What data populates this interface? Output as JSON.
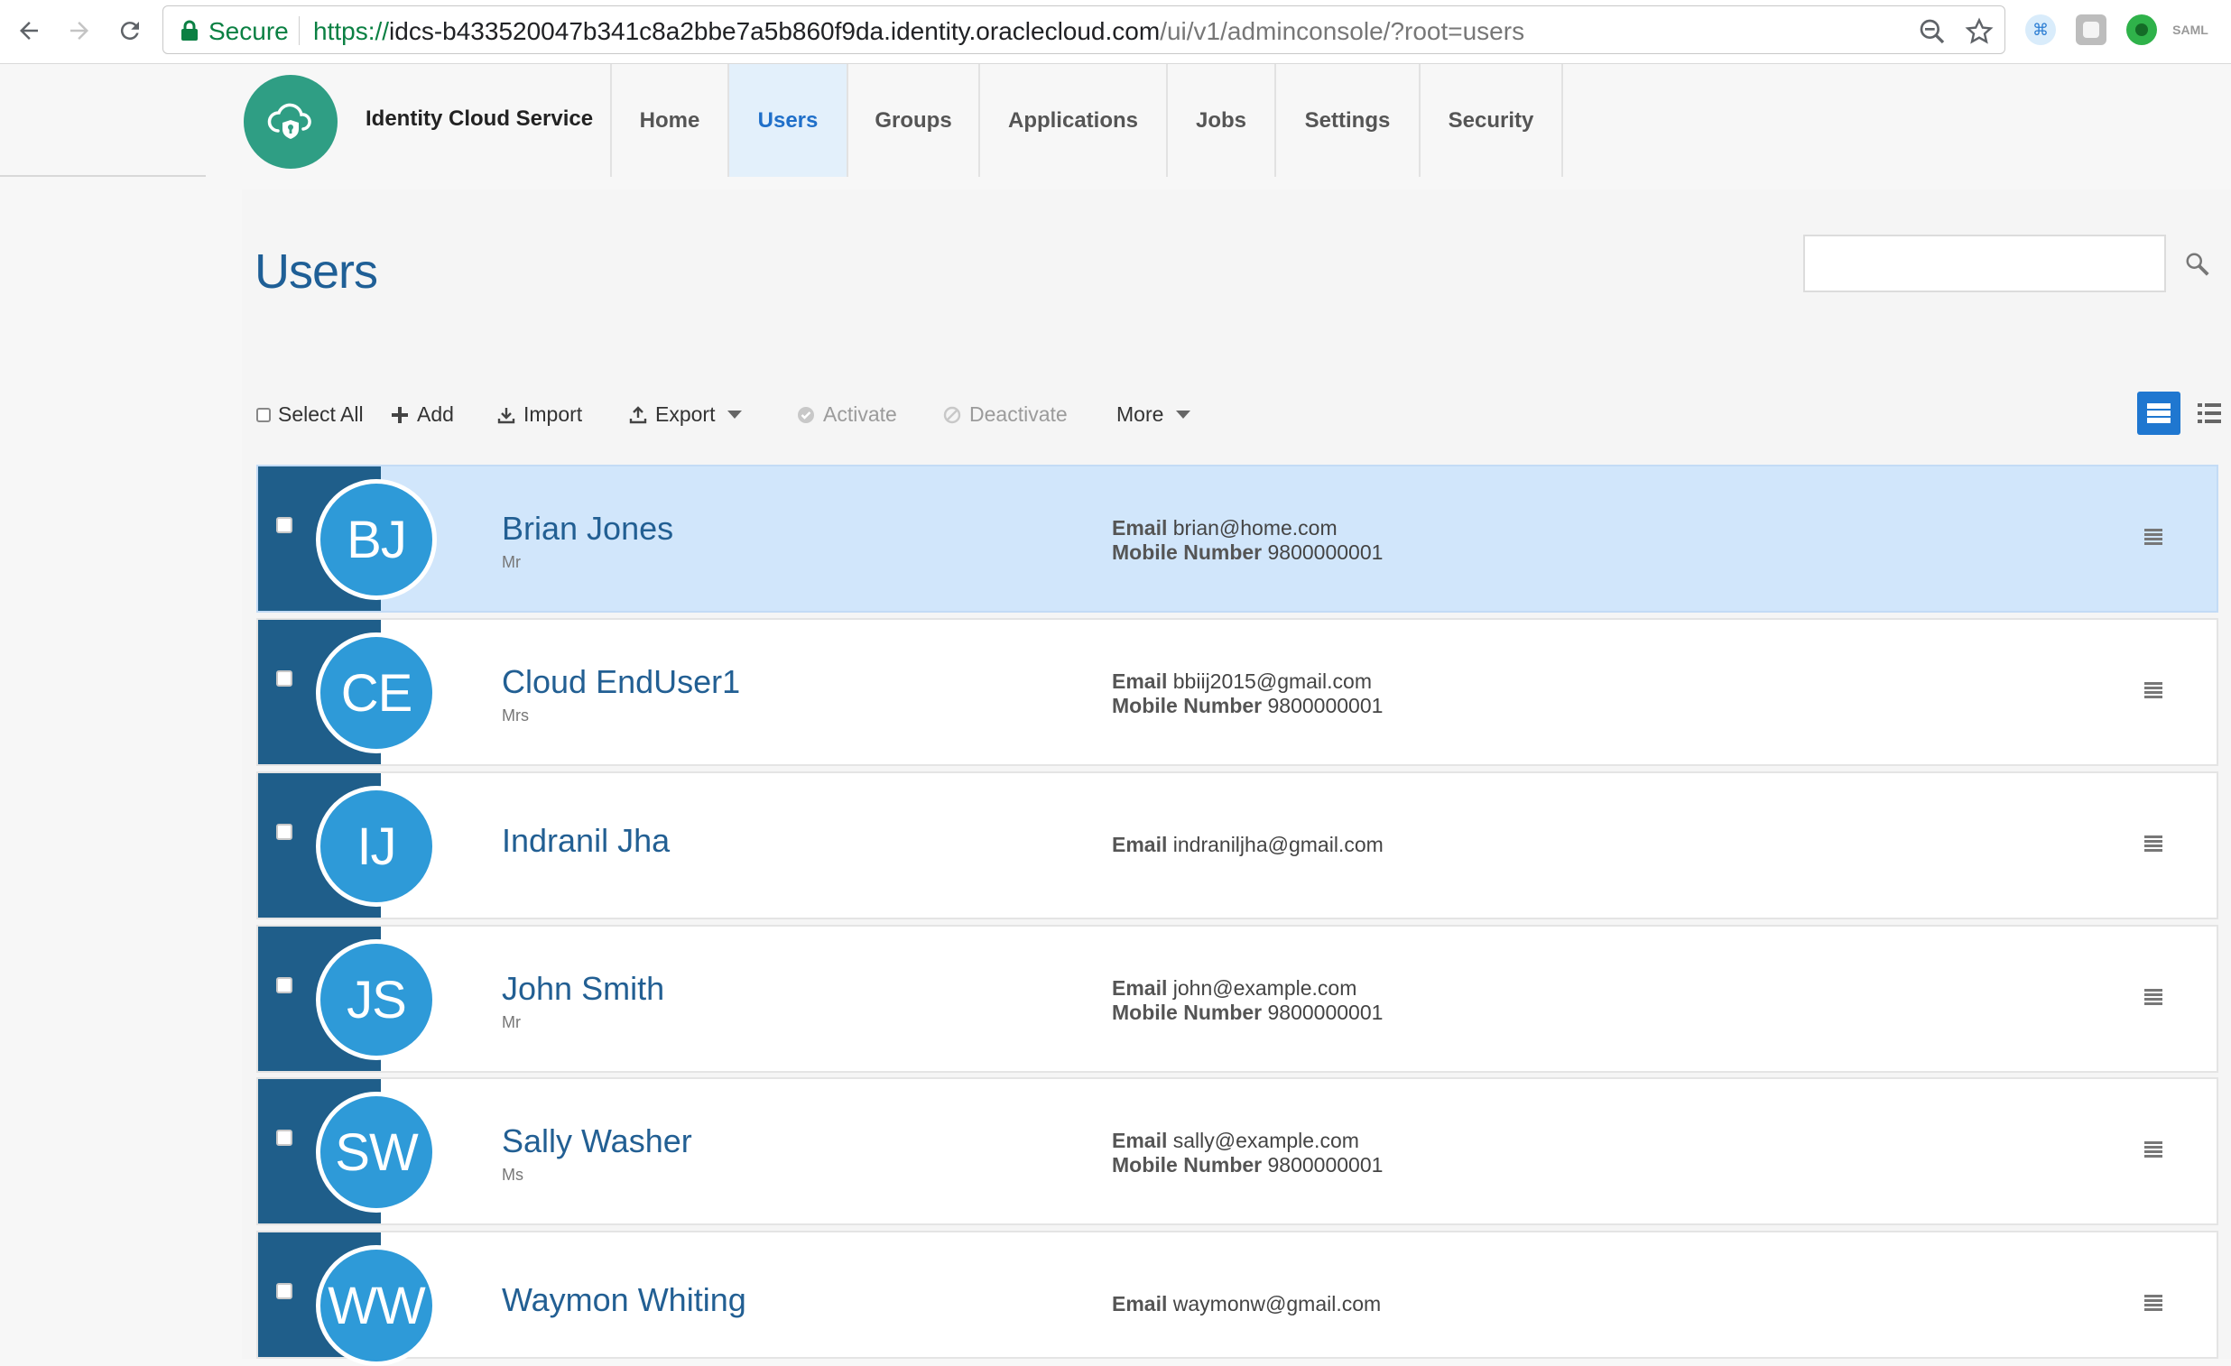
{
  "browser": {
    "secure_label": "Secure",
    "url_protocol": "https://",
    "url_host": "idcs-b433520047b341c8a2bbe7a5b860f9da.identity.oraclecloud.com",
    "url_path": "/ui/v1/adminconsole/?root=users",
    "extension_saml_label": "SAML"
  },
  "header": {
    "brand": "Identity Cloud Service",
    "tabs": [
      {
        "label": "Home",
        "active": false
      },
      {
        "label": "Users",
        "active": true
      },
      {
        "label": "Groups",
        "active": false
      },
      {
        "label": "Applications",
        "active": false
      },
      {
        "label": "Jobs",
        "active": false
      },
      {
        "label": "Settings",
        "active": false
      },
      {
        "label": "Security",
        "active": false
      }
    ]
  },
  "page": {
    "title": "Users",
    "search_placeholder": ""
  },
  "toolbar": {
    "select_all": "Select All",
    "add": "Add",
    "import": "Import",
    "export": "Export",
    "activate": "Activate",
    "deactivate": "Deactivate",
    "more": "More"
  },
  "labels": {
    "email": "Email",
    "mobile": "Mobile Number"
  },
  "users": [
    {
      "initials": "BJ",
      "name": "Brian Jones",
      "title": "Mr",
      "email": "brian@home.com",
      "mobile": "9800000001",
      "selected": true
    },
    {
      "initials": "CE",
      "name": "Cloud EndUser1",
      "title": "Mrs",
      "email": "bbiij2015@gmail.com",
      "mobile": "9800000001",
      "selected": false
    },
    {
      "initials": "IJ",
      "name": "Indranil Jha",
      "title": "",
      "email": "indraniljha@gmail.com",
      "mobile": "",
      "selected": false
    },
    {
      "initials": "JS",
      "name": "John Smith",
      "title": "Mr",
      "email": "john@example.com",
      "mobile": "9800000001",
      "selected": false
    },
    {
      "initials": "SW",
      "name": "Sally Washer",
      "title": "Ms",
      "email": "sally@example.com",
      "mobile": "9800000001",
      "selected": false
    },
    {
      "initials": "WW",
      "name": "Waymon Whiting",
      "title": "",
      "email": "waymonw@gmail.com",
      "mobile": "",
      "selected": false
    }
  ],
  "colors": {
    "accent": "#1f77d0",
    "avatar": "#2e9ad8",
    "strip": "#1f5e8a",
    "selected_row": "#d1e6fb",
    "logo": "#2f9e84"
  }
}
